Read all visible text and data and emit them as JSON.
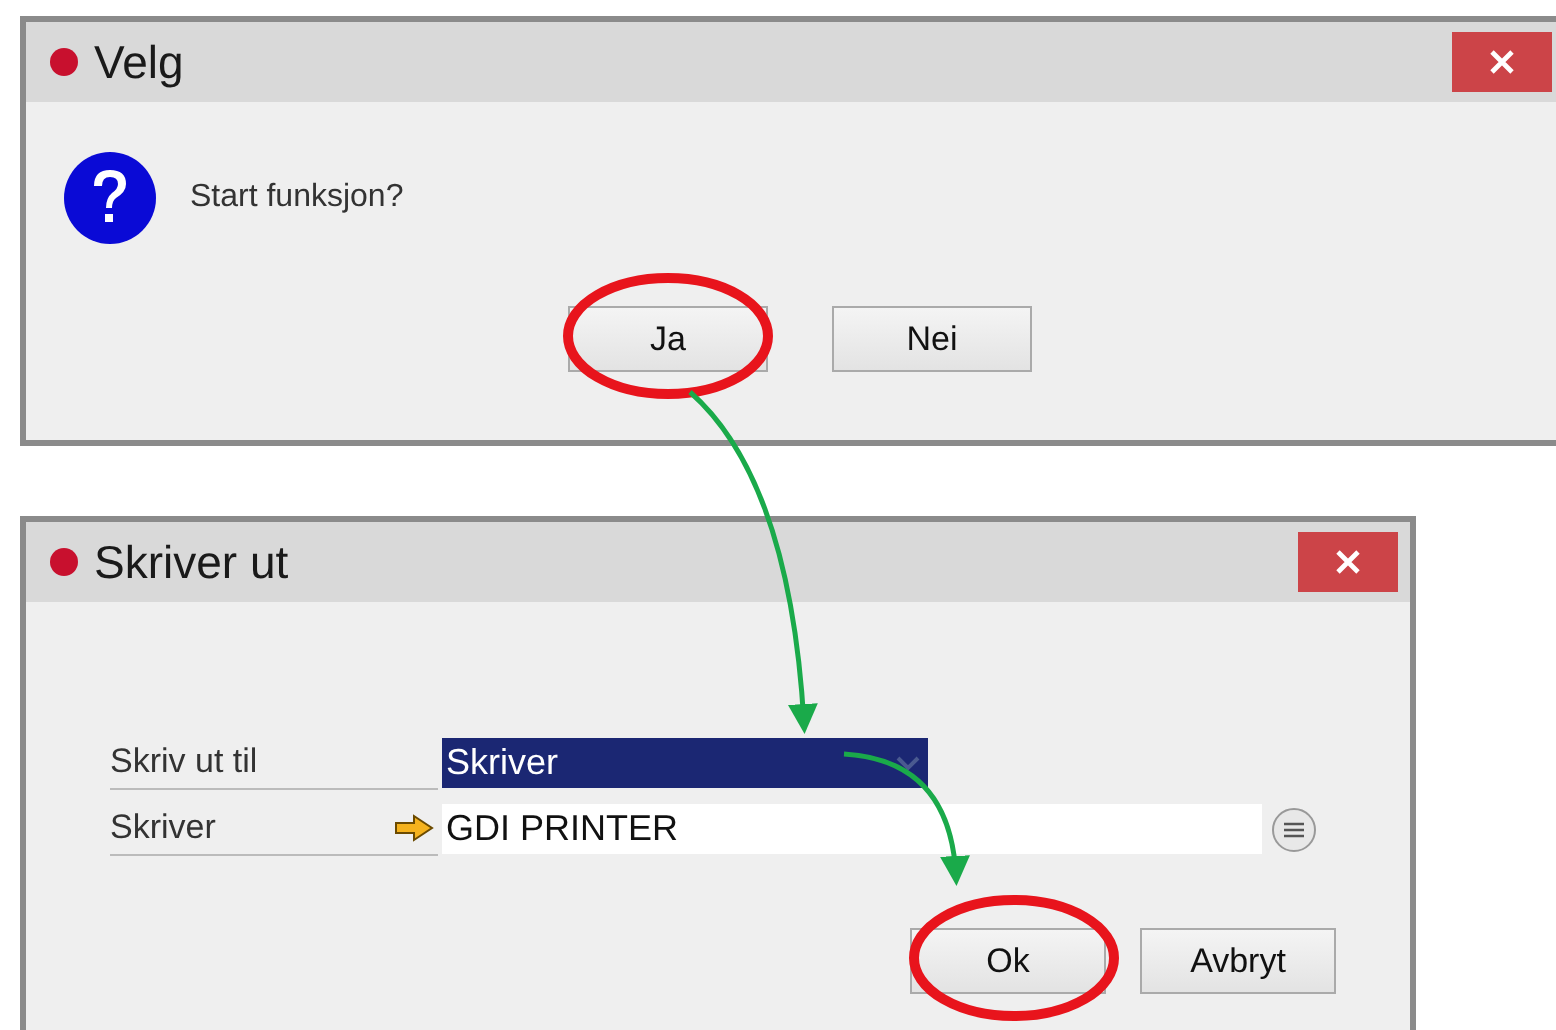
{
  "confirm_dialog": {
    "title": "Velg",
    "message": "Start funksjon?",
    "buttons": [
      "Ja",
      "Nei"
    ]
  },
  "print_dialog": {
    "title": "Skriver ut",
    "fields": [
      {
        "kind": "dropdown",
        "label": "Skriv ut til",
        "value": "Skriver"
      },
      {
        "kind": "lookup",
        "label": "Skriver",
        "value": "GDI PRINTER"
      }
    ],
    "buttons": [
      "Ok",
      "Avbryt"
    ]
  }
}
